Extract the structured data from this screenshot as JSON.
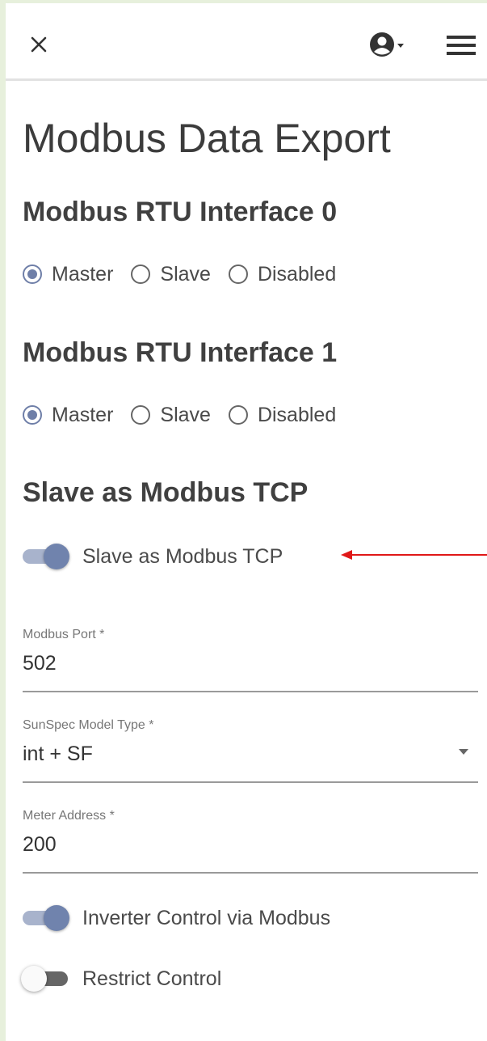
{
  "header": {
    "close_icon": "close-icon",
    "account_icon": "account-circle-icon",
    "menu_icon": "hamburger-menu-icon"
  },
  "page": {
    "title": "Modbus Data Export"
  },
  "rtu0": {
    "title": "Modbus RTU Interface 0",
    "options": [
      "Master",
      "Slave",
      "Disabled"
    ],
    "selected": "Master"
  },
  "rtu1": {
    "title": "Modbus RTU Interface 1",
    "options": [
      "Master",
      "Slave",
      "Disabled"
    ],
    "selected": "Master"
  },
  "tcp": {
    "title": "Slave as Modbus TCP",
    "toggle_label": "Slave as Modbus TCP",
    "toggle_on": true
  },
  "fields": {
    "port_label": "Modbus Port *",
    "port_value": "502",
    "sunspec_label": "SunSpec Model Type *",
    "sunspec_value": "int + SF",
    "meter_label": "Meter Address *",
    "meter_value": "200"
  },
  "controls": {
    "inverter_label": "Inverter Control via Modbus",
    "inverter_on": true,
    "restrict_label": "Restrict Control",
    "restrict_on": false
  },
  "colors": {
    "accent": "#7083ad",
    "annotation_arrow": "#e01818",
    "border_tint": "#e7f0dc"
  }
}
